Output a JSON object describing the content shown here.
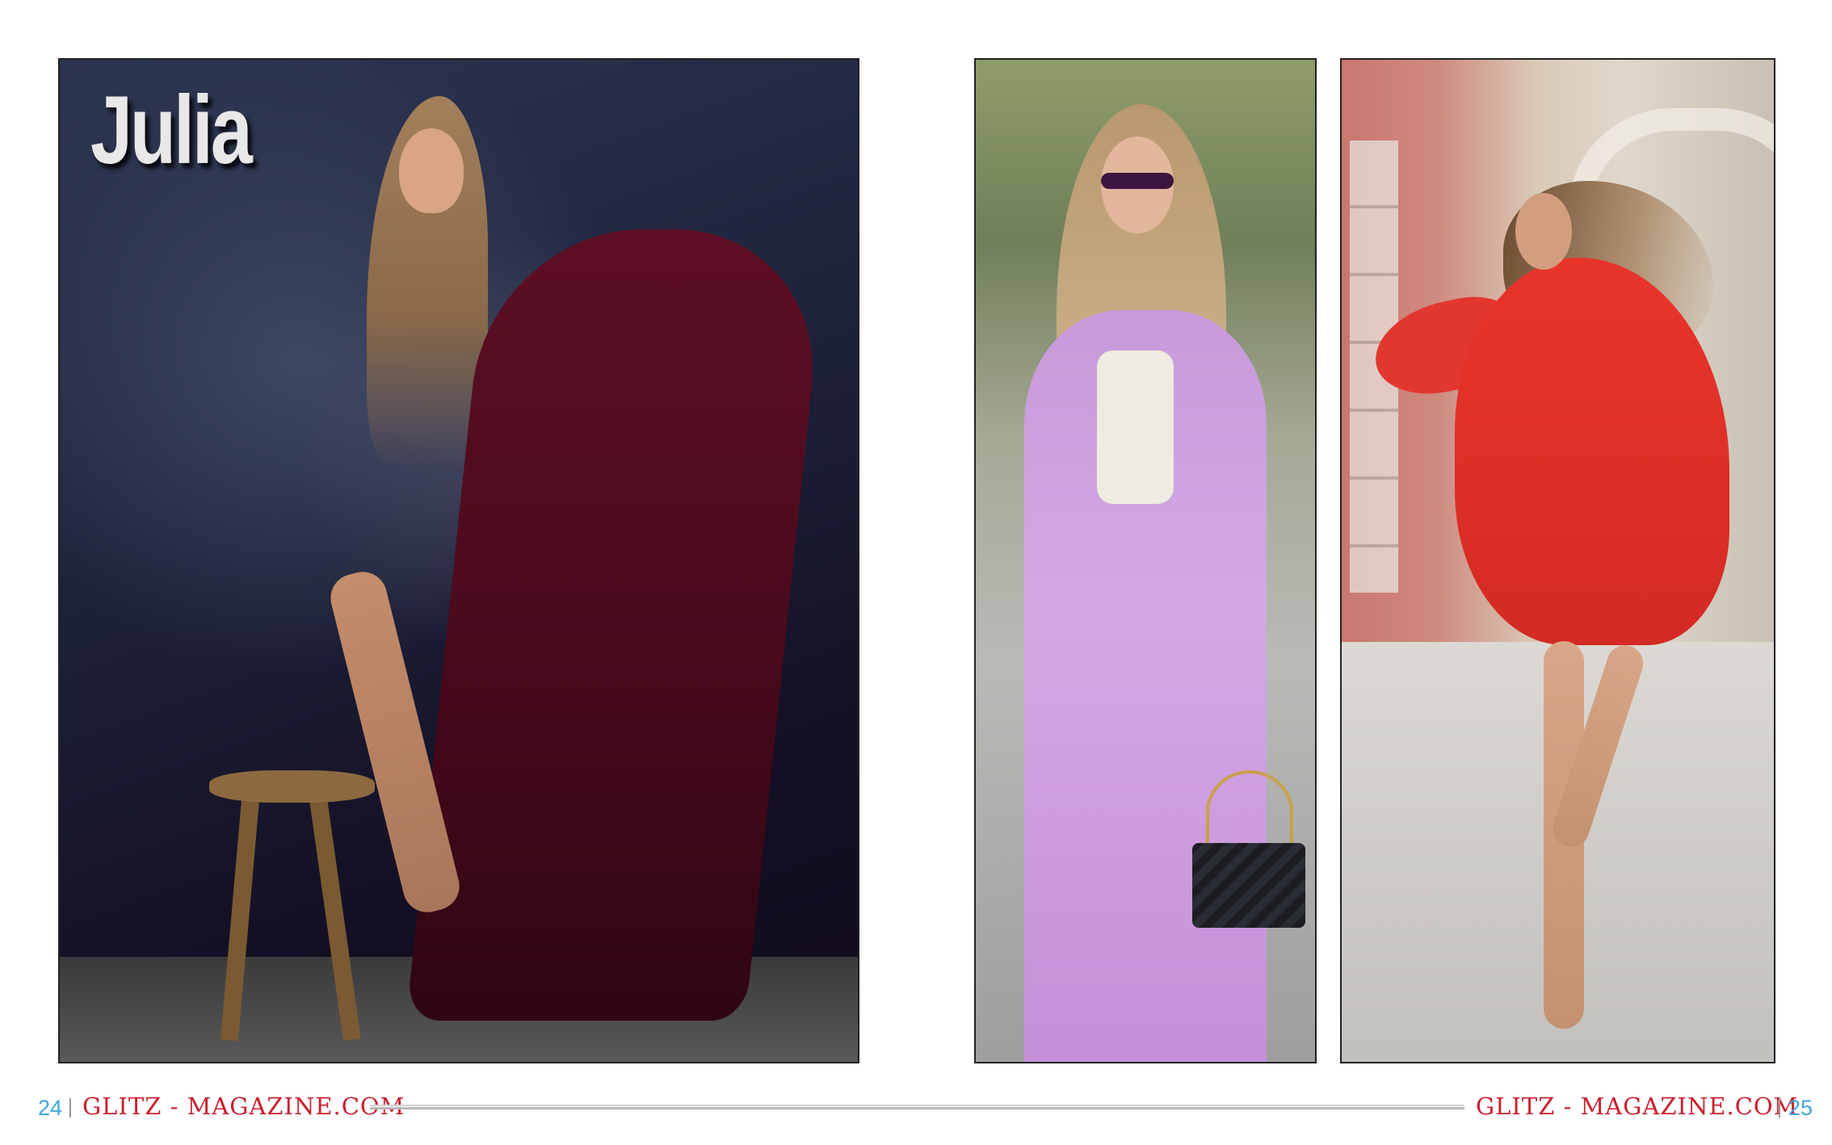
{
  "spread": {
    "title": "Julia",
    "left_page": {
      "number": "24",
      "site": "GLITZ - MAGAZINE.COM"
    },
    "right_page": {
      "number": "25",
      "site": "GLITZ - MAGAZINE.COM"
    }
  },
  "colors": {
    "site_text": "#cc1f2f",
    "page_number": "#3fa7d6",
    "title_text": "#e8e8e8"
  }
}
